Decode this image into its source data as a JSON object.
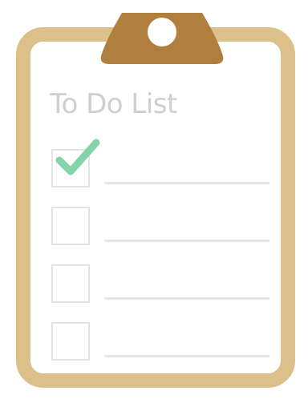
{
  "title": "To Do List",
  "colors": {
    "board_border": "#dcc089",
    "clip": "#b07f3e",
    "check": "#86d3aa",
    "checkbox_border": "#e3e3e3",
    "line": "#e6e6e6",
    "title": "#cfcfcf"
  },
  "tasks": [
    {
      "checked": true,
      "icon": "checkmark-icon"
    },
    {
      "checked": false
    },
    {
      "checked": false
    },
    {
      "checked": false
    }
  ]
}
